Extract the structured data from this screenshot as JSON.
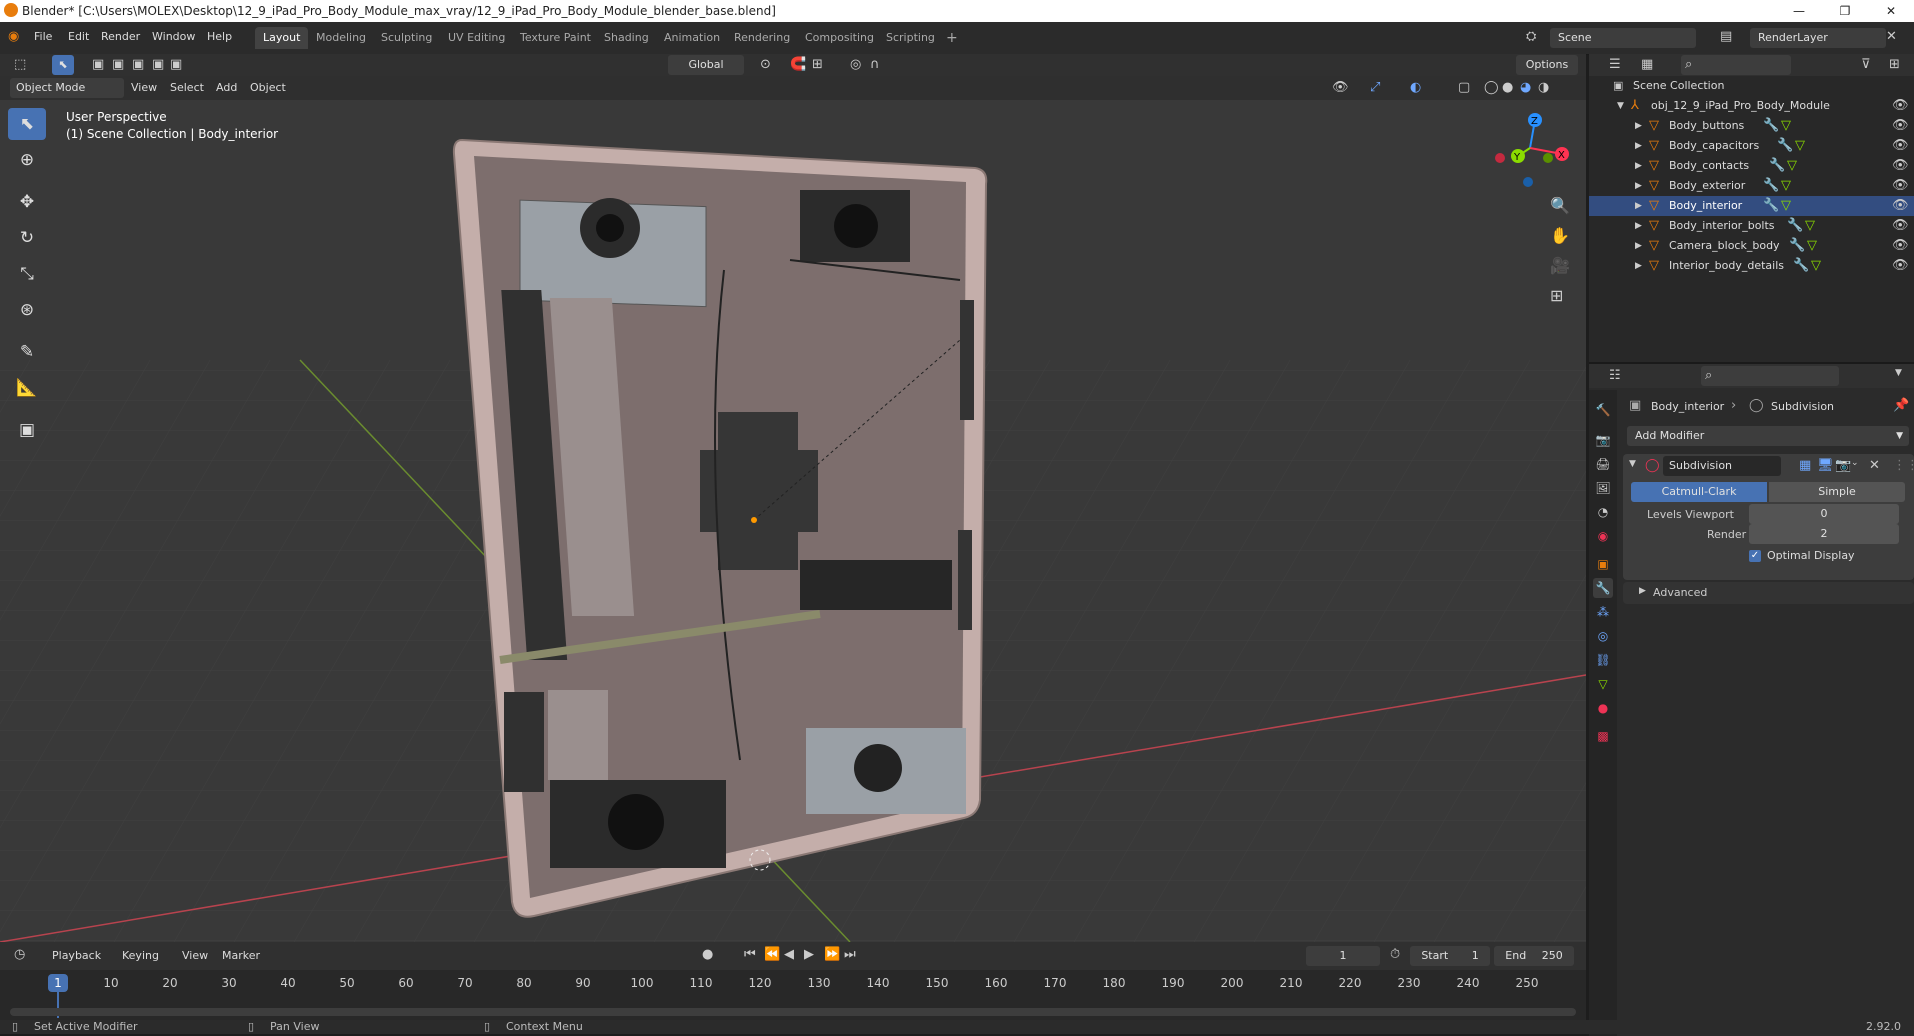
{
  "window": {
    "title": "Blender* [C:\\Users\\MOLEX\\Desktop\\12_9_iPad_Pro_Body_Module_max_vray/12_9_iPad_Pro_Body_Module_blender_base.blend]",
    "minimize": "—",
    "maximize": "❐",
    "close": "✕"
  },
  "menu": [
    "File",
    "Edit",
    "Render",
    "Window",
    "Help"
  ],
  "workspaces": [
    "Layout",
    "Modeling",
    "Sculpting",
    "UV Editing",
    "Texture Paint",
    "Shading",
    "Animation",
    "Rendering",
    "Compositing",
    "Scripting"
  ],
  "active_workspace": "Layout",
  "add_workspace": "+",
  "scene": "Scene",
  "render_layer": "RenderLayer",
  "viewport_header": {
    "transform_orientation": "Global",
    "options": "Options",
    "mode": "Object Mode",
    "menus": [
      "View",
      "Select",
      "Add",
      "Object"
    ]
  },
  "viewport_overlay": {
    "perspective": "User Perspective",
    "collection_info": "(1) Scene Collection | Body_interior"
  },
  "gizmo": {
    "x": "X",
    "y": "Y",
    "z": "Z"
  },
  "outliner": {
    "root": "Scene Collection",
    "object": "obj_12_9_iPad_Pro_Body_Module",
    "items": [
      {
        "name": "Body_buttons"
      },
      {
        "name": "Body_capacitors"
      },
      {
        "name": "Body_contacts"
      },
      {
        "name": "Body_exterior"
      },
      {
        "name": "Body_interior"
      },
      {
        "name": "Body_interior_bolts"
      },
      {
        "name": "Camera_block_body"
      },
      {
        "name": "Interior_body_details"
      }
    ],
    "selected_item": "Body_interior"
  },
  "properties": {
    "object_name": "Body_interior",
    "modifier_breadcrumb": "Subdivision",
    "add_modifier": "Add Modifier",
    "modifier_name": "Subdivision",
    "mode_catmull": "Catmull-Clark",
    "mode_simple": "Simple",
    "levels_viewport_label": "Levels Viewport",
    "levels_viewport_value": "0",
    "render_label": "Render",
    "render_value": "2",
    "optimal_display": "Optimal Display",
    "advanced": "Advanced"
  },
  "timeline": {
    "menus": [
      "Playback",
      "Keying",
      "View",
      "Marker"
    ],
    "current_frame": "1",
    "start_label": "Start",
    "start_value": "1",
    "end_label": "End",
    "end_value": "250",
    "ticks": [
      "10",
      "20",
      "30",
      "40",
      "50",
      "60",
      "70",
      "80",
      "90",
      "100",
      "110",
      "120",
      "130",
      "140",
      "150",
      "160",
      "170",
      "180",
      "190",
      "200",
      "210",
      "220",
      "230",
      "240",
      "250"
    ],
    "cursor": "1"
  },
  "status": {
    "left": "Set Active Modifier",
    "middle": "Pan View",
    "right": "Context Menu",
    "version": "2.92.0"
  },
  "colors": {
    "accent": "#4772b3",
    "object_orange": "#e87d0d",
    "axis_x": "#ff3352",
    "axis_y": "#8bdc00",
    "axis_z": "#2890ff"
  }
}
